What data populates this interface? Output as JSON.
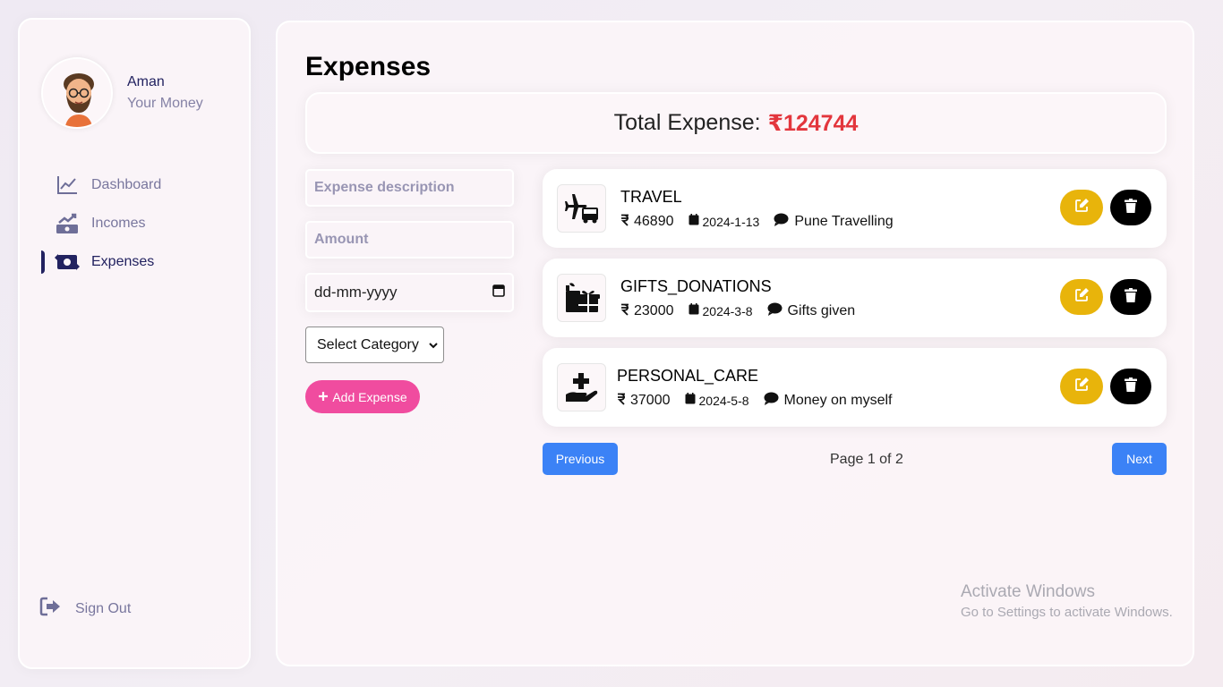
{
  "user": {
    "name": "Aman",
    "subtitle": "Your Money"
  },
  "nav": {
    "items": [
      {
        "label": "Dashboard",
        "icon": "chart-line-icon",
        "active": false
      },
      {
        "label": "Incomes",
        "icon": "money-growth-icon",
        "active": false
      },
      {
        "label": "Expenses",
        "icon": "money-bill-transfer-icon",
        "active": true
      }
    ],
    "signout": "Sign Out"
  },
  "page": {
    "title": "Expenses"
  },
  "total": {
    "label": "Total Expense:",
    "value": "₹124744"
  },
  "form": {
    "description_placeholder": "Expense description",
    "amount_placeholder": "Amount",
    "date_placeholder": "dd-mm-yyyy",
    "category_selected": "Select Category",
    "add_button": "Add Expense"
  },
  "expenses": [
    {
      "title": "TRAVEL",
      "amount": "46890",
      "date": "2024-1-13",
      "description": "Pune Travelling",
      "icon": "travel-icon"
    },
    {
      "title": "GIFTS_DONATIONS",
      "amount": "23000",
      "date": "2024-3-8",
      "description": "Gifts given",
      "icon": "gifts-icon"
    },
    {
      "title": "PERSONAL_CARE",
      "amount": "37000",
      "date": "2024-5-8",
      "description": "Money on myself",
      "icon": "hand-holding-medical-icon"
    }
  ],
  "pagination": {
    "previous": "Previous",
    "info": "Page 1 of 2",
    "next": "Next"
  },
  "watermark": {
    "line1": "Activate Windows",
    "line2": "Go to Settings to activate Windows."
  },
  "colors": {
    "accent": "#222260",
    "total": "#e3363d",
    "add": "#f04c9f",
    "edit": "#e8b40b",
    "pager": "#3b82f6"
  }
}
